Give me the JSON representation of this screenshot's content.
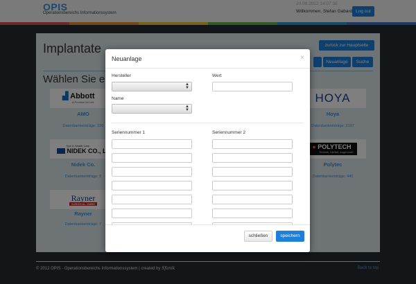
{
  "header": {
    "brand": "OPIS",
    "brand_sub": "Operationsbereichs Informationssystem",
    "timestamp": "20.09.2012 14:07:36",
    "welcome": "Willkommen, Stefan Gabard",
    "logout_label": "Log out",
    "stripe_colors": [
      "#d9534f",
      "#ef8c2e",
      "#f1c232",
      "#58b947",
      "#2b9bd3",
      "#3a73c9"
    ]
  },
  "page": {
    "title": "Implantate",
    "back_label": "zurück zur Hauptseite",
    "neuanlage_label": "Neuanlage",
    "suche_label": "Suche",
    "subtitle": "Wählen Sie ein"
  },
  "manufacturers": [
    {
      "logo": "Abbott",
      "logo_sub": "A Promise for Life",
      "name": "AMO",
      "count": "Datenbankeinträge: 220"
    },
    {
      "logo": "HOYA",
      "logo_sub": "",
      "name": "Hoya",
      "count": "Datenbankeinträge: 2197"
    },
    {
      "logo": "NIDEK CO., LT",
      "logo_sub": "Eye & Health Care",
      "name": "Nidek Co.",
      "count": "Datenbankeinträge: 5"
    },
    {
      "logo": "POLYTECH",
      "logo_sub": "Technik, Vielfalt, Augenmaß",
      "name": "Polytec",
      "count": "Datenbankeinträge: 440"
    },
    {
      "logo": "Rayner",
      "logo_sub": "SURGICAL GMBH",
      "name": "Rayner",
      "count": "Datenbankeinträge: 7"
    }
  ],
  "footer": {
    "copyright": "© 2012 OPIS - Operationsbereichs Informationssystem | created by",
    "creator": "Sfanik",
    "back_to_top": "Back to top"
  },
  "modal": {
    "title": "Neuanlage",
    "close_glyph": "×",
    "hersteller_label": "Hersteller",
    "wert_label": "Wert",
    "name_label": "Name",
    "seriennummer1_label": "Seriennummer 1",
    "seriennummer2_label": "Seriennummer 2",
    "hersteller_value": "",
    "name_value": "",
    "wert_value": "",
    "serial_rows": 7,
    "cancel_label": "schließen",
    "save_label": "speichern"
  }
}
